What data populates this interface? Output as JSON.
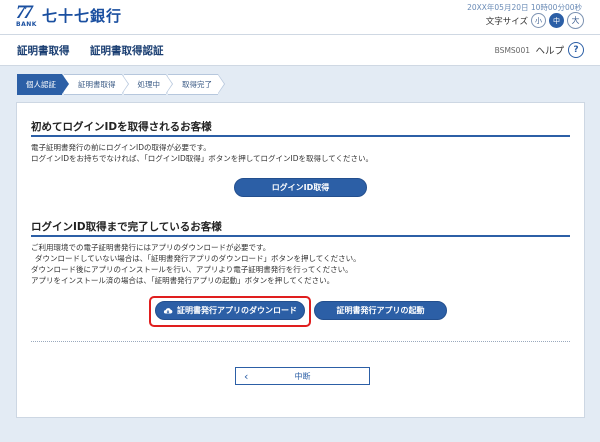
{
  "brand": {
    "mark": "77",
    "mark_sub": "BANK",
    "name": "七十七銀行"
  },
  "datetime": "20XX年05月20日 10時00分00秒",
  "font_size": {
    "label": "文字サイズ",
    "small": "小",
    "medium": "中",
    "large": "大",
    "selected": "中"
  },
  "header": {
    "title": "証明書取得",
    "subtitle": "証明書取得認証",
    "screen_id": "BSMS001",
    "help_label": "ヘルプ",
    "help_icon": "?"
  },
  "steps": [
    {
      "label": "個人認証",
      "active": true
    },
    {
      "label": "証明書取得",
      "active": false
    },
    {
      "label": "処理中",
      "active": false
    },
    {
      "label": "取得完了",
      "active": false
    }
  ],
  "section1": {
    "title": "初めてログインIDを取得されるお客様",
    "lines": [
      "電子証明書発行の前にログインIDの取得が必要です。",
      "ログインIDをお持ちでなければ、「ログインID取得」ボタンを押してログインIDを取得してください。"
    ],
    "button": "ログインID取得"
  },
  "section2": {
    "title": "ログインID取得まで完了しているお客様",
    "lines": [
      "ご利用環境での電子証明書発行にはアプリのダウンロードが必要です。",
      "ダウンロードしていない場合は、「証明書発行アプリのダウンロード」ボタンを押してください。",
      "ダウンロード後にアプリのインストールを行い、アプリより電子証明書発行を行ってください。",
      "アプリをインストール済の場合は、「証明書発行アプリの起動」ボタンを押してください。"
    ],
    "download_button": "証明書発行アプリのダウンロード",
    "launch_button": "証明書発行アプリの起動"
  },
  "cancel": {
    "label": "中断",
    "icon": "chevron-left"
  },
  "colors": {
    "accent": "#2c5fa6",
    "highlight": "#e01e1e",
    "background": "#e3ebf4"
  }
}
